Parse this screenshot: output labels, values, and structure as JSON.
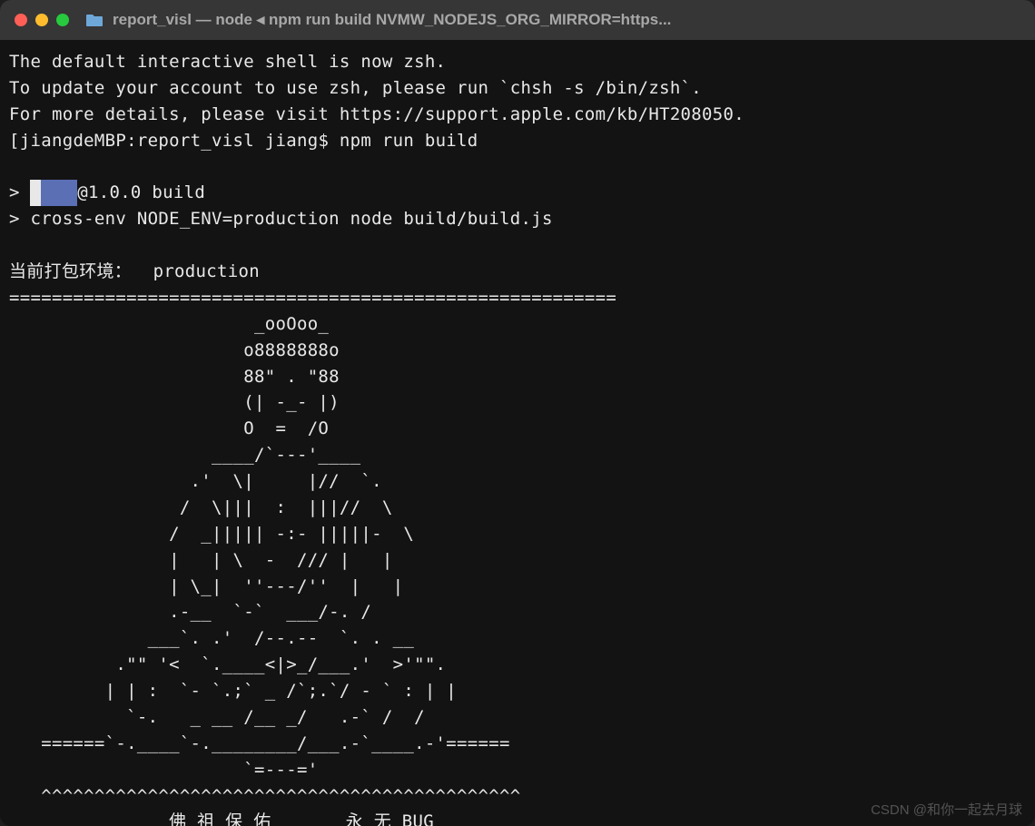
{
  "window": {
    "title": "report_visl — node ◂ npm run build NVMW_NODEJS_ORG_MIRROR=https..."
  },
  "terminal": {
    "line1": "The default interactive shell is now zsh.",
    "line2": "To update your account to use zsh, please run `chsh -s /bin/zsh`.",
    "line3": "For more details, please visit https://support.apple.com/kb/HT208050.",
    "prompt_open": "[",
    "prompt": "jiangdeMBP:report_visl jiang$ ",
    "cmd": "npm run build",
    "prompt_close": "]",
    "blank": "",
    "script_prefix": "> ",
    "redact_pre": " ",
    "version_suffix": "@1.0.0 build",
    "script2": "> cross-env NODE_ENV=production node build/build.js",
    "env_label": "当前打包环境：  production",
    "divider": "=========================================================",
    "art01": "                       _ooOoo_",
    "art02": "                      o8888888o",
    "art03": "                      88\" . \"88",
    "art04": "                      (| -_- |)",
    "art05": "                      O  =  /O",
    "art06": "                   ____/`---'____",
    "art07": "                 .'  \\|     |//  `.",
    "art08": "                /  \\|||  :  |||//  \\",
    "art09": "               /  _||||| -:- |||||-  \\",
    "art10": "               |   | \\  -  /// |   |",
    "art11": "               | \\_|  ''---/''  |   |",
    "art12": "               .-__  `-`  ___/-. /",
    "art13": "             ___`. .'  /--.--  `. . __",
    "art14": "          .\"\" '<  `.____<|>_/___.'  >'\"\".",
    "art15": "         | | :  `- `.;` _ /`;.`/ - ` : | |",
    "art16": "           `-.   _ __ /__ _/   .-` /  /",
    "art17": "   ======`-.____`-.________/___.-`____.-'======",
    "art18": "                      `=---='",
    "art19": "   ^^^^^^^^^^^^^^^^^^^^^^^^^^^^^^^^^^^^^^^^^^^^^",
    "blessing": "               佛 祖 保 佑       永 无 BUG"
  },
  "watermark": "CSDN @和你一起去月球"
}
